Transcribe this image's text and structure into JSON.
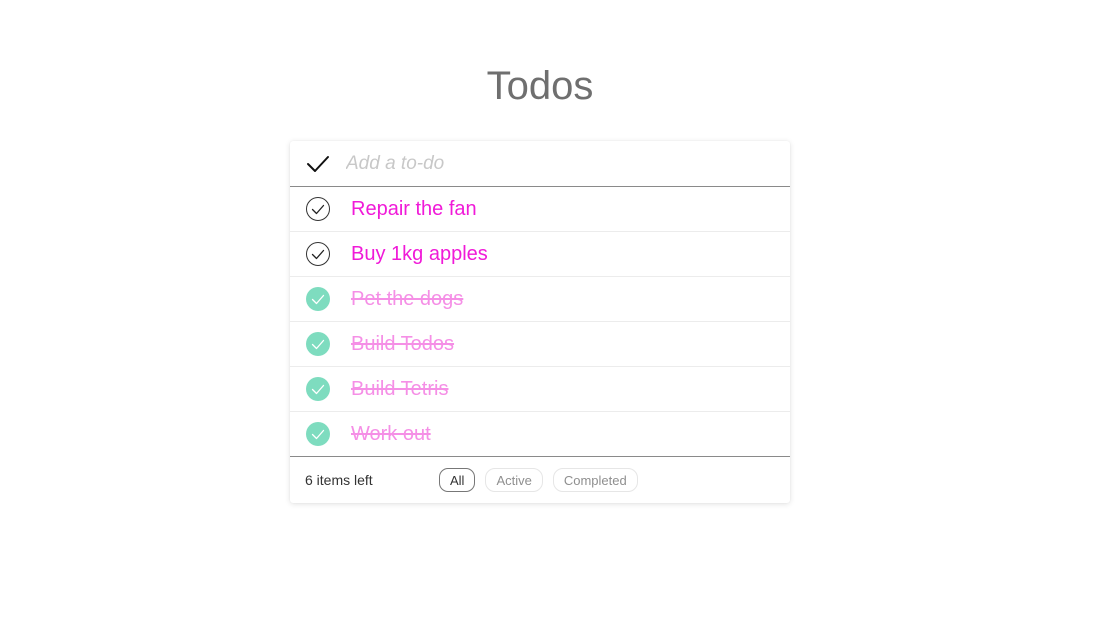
{
  "app": {
    "title": "Todos"
  },
  "new_todo": {
    "placeholder": "Add a to-do"
  },
  "todos": [
    {
      "text": "Repair the fan",
      "completed": false
    },
    {
      "text": "Buy 1kg apples",
      "completed": false
    },
    {
      "text": "Pet the dogs",
      "completed": true
    },
    {
      "text": "Build Todos",
      "completed": true
    },
    {
      "text": "Build Tetris",
      "completed": true
    },
    {
      "text": "Work out",
      "completed": true
    }
  ],
  "footer": {
    "count_label": "6 items left",
    "filters": [
      {
        "label": "All",
        "selected": true
      },
      {
        "label": "Active",
        "selected": false
      },
      {
        "label": "Completed",
        "selected": false
      }
    ]
  },
  "colors": {
    "active_text": "#f01ad8",
    "completed_text": "#f58fe6",
    "completed_check": "#7edcbf",
    "title": "#6f6f6f"
  },
  "icons": {
    "toggle_all": "checkmark-icon",
    "item_check": "check-circle-icon"
  }
}
